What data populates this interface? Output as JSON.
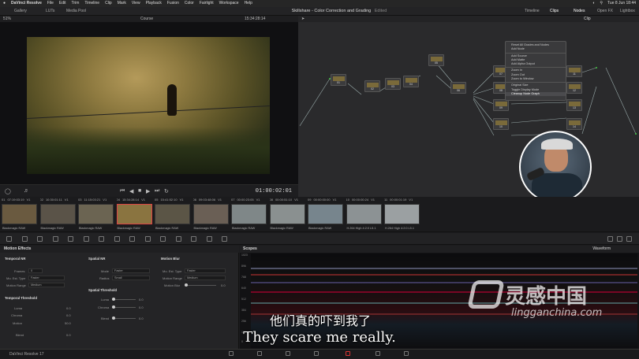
{
  "menubar": {
    "apple": "",
    "items": [
      "DaVinci Resolve",
      "File",
      "Edit",
      "Trim",
      "Timeline",
      "Clip",
      "Mark",
      "View",
      "Playback",
      "Fusion",
      "Color",
      "Fairlight",
      "Workspace",
      "Help"
    ],
    "clock": "Tue 8 Jun 18:44"
  },
  "toolbar": {
    "gallery": "Gallery",
    "luts": "LUTs",
    "media_pool": "Media Pool",
    "timeline": "Timeline",
    "clips": "Clips",
    "nodes": "Nodes",
    "open_fx": "Open FX",
    "lightbox": "Lightbox"
  },
  "title": {
    "project": "Skillshare - Color Correction and Grading",
    "status": "Edited"
  },
  "viewer": {
    "zoom": "51%",
    "clip_name": "Course",
    "timecode_in": "15:34:28:14",
    "timecode_out": "01:00:02:01"
  },
  "nodes": {
    "mode": "Clip",
    "items": [
      {
        "label": "01"
      },
      {
        "label": "02"
      },
      {
        "label": "03"
      },
      {
        "label": "04"
      },
      {
        "label": "05"
      },
      {
        "label": "06"
      },
      {
        "label": "07"
      },
      {
        "label": "08"
      },
      {
        "label": "09"
      },
      {
        "label": "10"
      },
      {
        "label": "11"
      },
      {
        "label": "12"
      },
      {
        "label": "13"
      },
      {
        "label": "14"
      }
    ]
  },
  "context_menu": {
    "items": [
      {
        "label": "Reset All Grades and Nodes",
        "type": "item"
      },
      {
        "label": "Add Node",
        "type": "item"
      },
      {
        "label": "",
        "type": "sep"
      },
      {
        "label": "Add Source",
        "type": "item"
      },
      {
        "label": "Add Matte",
        "type": "item"
      },
      {
        "label": "Add Alpha Output",
        "type": "item"
      },
      {
        "label": "",
        "type": "sep"
      },
      {
        "label": "Zoom In",
        "type": "item"
      },
      {
        "label": "Zoom Out",
        "type": "item"
      },
      {
        "label": "Zoom to Window",
        "type": "item"
      },
      {
        "label": "",
        "type": "sep"
      },
      {
        "label": "Original Size",
        "type": "item"
      },
      {
        "label": "Toggle Display Mode",
        "type": "item"
      },
      {
        "label": "Cleanup Node Graph",
        "type": "item",
        "highlight": true
      }
    ]
  },
  "clips": [
    {
      "num": "01",
      "tc": "07:19:03:19",
      "track": "V1",
      "codec": "Blackmagic RAW",
      "color": "#6a5a40"
    },
    {
      "num": "02",
      "tc": "10:30:01:11",
      "track": "V1",
      "codec": "Blackmagic RAW",
      "color": "#5a5348"
    },
    {
      "num": "03",
      "tc": "11:15:03:21",
      "track": "V1",
      "codec": "Blackmagic RAW",
      "color": "#6b6452"
    },
    {
      "num": "04",
      "tc": "15:34:28:14",
      "track": "V1",
      "codec": "Blackmagic RAW",
      "color": "#8a7440",
      "selected": true
    },
    {
      "num": "05",
      "tc": "15:41:52:10",
      "track": "V1",
      "codec": "Blackmagic RAW",
      "color": "#5b5546"
    },
    {
      "num": "06",
      "tc": "09:03:48:06",
      "track": "V1",
      "codec": "Blackmagic RAW",
      "color": "#6a5f55"
    },
    {
      "num": "07",
      "tc": "00:00:23:05",
      "track": "V1",
      "codec": "Blackmagic RAW",
      "color": "#7f8788"
    },
    {
      "num": "08",
      "tc": "00:00:51:10",
      "track": "V1",
      "codec": "Blackmagic RAW",
      "color": "#8a9090"
    },
    {
      "num": "09",
      "tc": "00:00:00:00",
      "track": "V1",
      "codec": "Blackmagic RAW",
      "color": "#77858d"
    },
    {
      "num": "10",
      "tc": "00:00:00:24",
      "track": "V1",
      "codec": "H.264 High 4:2:0 L5.1",
      "color": "#8c9294"
    },
    {
      "num": "11",
      "tc": "00:00:01:19",
      "track": "V1",
      "codec": "H.264 High 4:2:0 L5.1",
      "color": "#9ba0a2"
    }
  ],
  "motion_effects": {
    "header": "Motion Effects",
    "temporal_nr": "Temporal NR",
    "frames_label": "Frames",
    "frames_value": "0",
    "mo_est_type_label": "Mo. Est. Type",
    "mo_est_type_value": "Faster",
    "motion_range_label": "Motion Range",
    "motion_range_value": "Medium",
    "temporal_threshold": "Temporal Threshold",
    "tt_luma": "Luma",
    "tt_chroma": "Chroma",
    "tt_motion": "Motion",
    "tt_blend": "Blend",
    "tt_values": [
      "0.0",
      "0.0",
      "50.0",
      "0.0"
    ],
    "spatial_nr": "Spatial NR",
    "mode_label": "Mode",
    "mode_value": "Faster",
    "radius_label": "Radius",
    "radius_value": "Small",
    "spatial_threshold": "Spatial Threshold",
    "st_luma": "Luma",
    "st_chroma": "Chroma",
    "st_blend": "Blend",
    "st_values": [
      "0.0",
      "0.0",
      "0.0"
    ],
    "motion_blur": "Motion Blur",
    "mb_type_label": "Mo. Est. Type",
    "mb_type_value": "Faster",
    "mb_range_label": "Motion Range",
    "mb_range_value": "Medium",
    "mb_blur_label": "Motion Blur",
    "mb_blur_value": "0.0"
  },
  "scopes": {
    "header": "Scopes",
    "mode": "Waveform",
    "y_labels": [
      "1023",
      "896",
      "768",
      "640",
      "512",
      "384",
      "256",
      "128",
      "0"
    ]
  },
  "subtitles": {
    "chinese": "他们真的吓到我了",
    "english": "They scare me really."
  },
  "watermark": {
    "chinese": "灵感中国",
    "english": "lingganchina.com"
  },
  "statusbar": {
    "app": "DaVinci Resolve 17"
  }
}
